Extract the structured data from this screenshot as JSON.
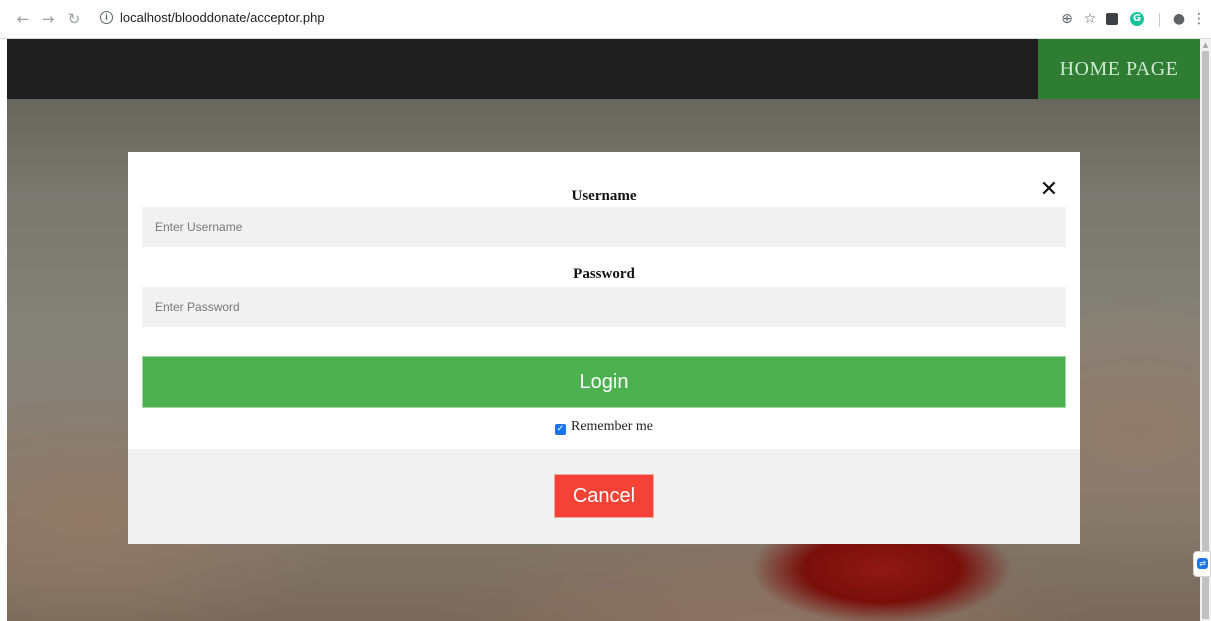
{
  "browser": {
    "url": "localhost/blooddonate/acceptor.php"
  },
  "nav": {
    "home_label": "HOME PAGE"
  },
  "modal": {
    "username": {
      "label": "Username",
      "placeholder": "Enter Username",
      "value": ""
    },
    "password": {
      "label": "Password",
      "placeholder": "Enter Password",
      "value": ""
    },
    "login_label": "Login",
    "remember_label": "Remember me",
    "remember_checked": true,
    "cancel_label": "Cancel",
    "close_glyph": "✕"
  },
  "colors": {
    "login_green": "#4caf50",
    "cancel_red": "#f44336",
    "home_green": "#2e7d32",
    "topbar": "#1e1e1e"
  }
}
